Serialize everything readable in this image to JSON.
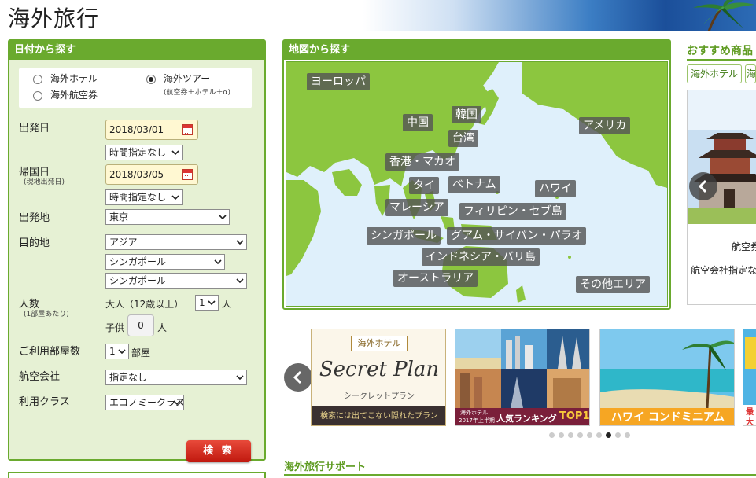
{
  "header": {
    "title": "海外旅行"
  },
  "search": {
    "title": "日付から探す",
    "types": {
      "hotel": "海外ホテル",
      "flight": "海外航空券",
      "tour": "海外ツアー",
      "tour_note": "(航空券＋ホテル＋α)",
      "selected": "海外ツアー"
    },
    "depart_label": "出発日",
    "depart_date": "2018/03/01",
    "depart_time": "時間指定なし",
    "return_label": "帰国日",
    "return_note": "(現地出発日)",
    "return_date": "2018/03/05",
    "return_time": "時間指定なし",
    "origin_label": "出発地",
    "origin": "東京",
    "destination_label": "目的地",
    "dest_area": "アジア",
    "dest_country": "シンガポール",
    "dest_city": "シンガポール",
    "people_label": "人数",
    "people_note": "(1部屋あたり)",
    "adults_label": "大人（12歳以上）",
    "adults": "1",
    "person_unit": "人",
    "children_label": "子供",
    "children": "0",
    "rooms_label": "ご利用部屋数",
    "rooms": "1",
    "rooms_unit": "部屋",
    "airline_label": "航空会社",
    "airline": "指定なし",
    "class_label": "利用クラス",
    "class": "エコノミークラス",
    "submit": "検 索"
  },
  "map": {
    "title": "地図から探す",
    "regions": [
      "ヨーロッパ",
      "中国",
      "韓国",
      "台湾",
      "アメリカ",
      "香港・マカオ",
      "タイ",
      "ベトナム",
      "ハワイ",
      "マレーシア",
      "フィリピン・セブ島",
      "シンガポール",
      "グアム・サイパン・パラオ",
      "インドネシア・バリ島",
      "オーストラリア",
      "その他エリア"
    ]
  },
  "recommend": {
    "title": "おすすめ商品",
    "tabs": [
      "海外ホテル",
      "海"
    ],
    "card_line1": "航空券",
    "card_line2": "航空会社指定な"
  },
  "banners": {
    "secret": {
      "badge": "海外ホテル",
      "script": "Secret Plan",
      "sub": "シークレットプラン",
      "foot": "検索には出てこない隠れたプラン"
    },
    "ranking": {
      "small": "海外ホテル",
      "year": "2017年上半期",
      "title": "人気ランキング",
      "top": "TOP10"
    },
    "hawaii": {
      "caption": "ハワイ コンドミニアム"
    },
    "partial": {
      "l1": "最",
      "l2": "大"
    },
    "dots_total": 9,
    "dots_active": 7
  },
  "support": {
    "title": "海外旅行サポート"
  },
  "colors": {
    "accent": "#6aaa2e",
    "panel_bg": "#e6f1d4",
    "search_button": "#d42a1d",
    "ocean": "#dff0fb",
    "land": "#8cc63f"
  },
  "icons": [
    "calendar-icon",
    "chevron-down-icon",
    "chevron-left-icon"
  ]
}
